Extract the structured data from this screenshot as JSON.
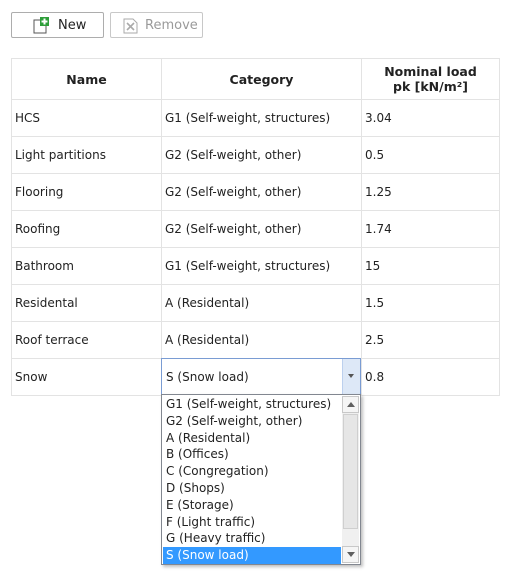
{
  "toolbar": {
    "new_label": "New",
    "new_icon": "add-document-icon",
    "remove_label": "Remove",
    "remove_icon": "remove-document-icon"
  },
  "table": {
    "headers": {
      "name": "Name",
      "category": "Category",
      "load_line1": "Nominal load",
      "load_line2": "pk [kN/m²]"
    },
    "rows": [
      {
        "name": "HCS",
        "category": "G1 (Self-weight, structures)",
        "load": "3.04"
      },
      {
        "name": "Light partitions",
        "category": "G2 (Self-weight, other)",
        "load": "0.5"
      },
      {
        "name": "Flooring",
        "category": "G2 (Self-weight, other)",
        "load": "1.25"
      },
      {
        "name": "Roofing",
        "category": "G2 (Self-weight, other)",
        "load": "1.74"
      },
      {
        "name": "Bathroom",
        "category": "G1 (Self-weight, structures)",
        "load": "15"
      },
      {
        "name": "Residental",
        "category": "A (Residental)",
        "load": "1.5"
      },
      {
        "name": "Roof terrace",
        "category": "A (Residental)",
        "load": "2.5"
      },
      {
        "name": "Snow",
        "category": "S (Snow load)",
        "load": "0.8"
      }
    ]
  },
  "dropdown": {
    "selected": "S (Snow load)",
    "options": [
      "G1 (Self-weight, structures)",
      "G2 (Self-weight, other)",
      "A (Residental)",
      "B (Offices)",
      "C (Congregation)",
      "D (Shops)",
      "E (Storage)",
      "F (Light traffic)",
      "G (Heavy traffic)",
      "S (Snow load)"
    ]
  },
  "colors": {
    "selection": "#3399ff",
    "add_icon": "#2e9e3a",
    "grid_border": "#e3e3e3"
  }
}
